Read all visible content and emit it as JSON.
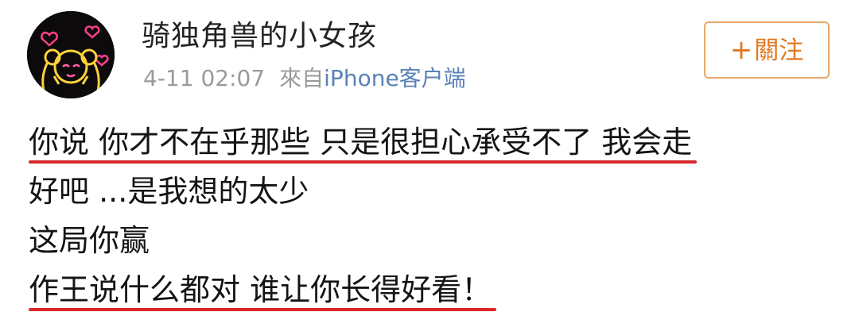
{
  "post": {
    "username": "骑独角兽的小女孩",
    "time": "4-11 02:07",
    "source_label": "來自",
    "source_device": "iPhone客户端",
    "follow_button": "關注",
    "lines": [
      "你说 你才不在乎那些 只是很担心承受不了 我会走",
      "好吧 ...是我想的太少",
      "这局你赢",
      "作王说什么都对 谁让你长得好看！"
    ]
  },
  "colors": {
    "underline": "#d8262a",
    "follow_text": "#e07a1f",
    "follow_border": "#e8a86a",
    "source_device": "#5a82b6",
    "meta": "#9a9a9a"
  },
  "icons": {
    "avatar": "sailor-moon-neon-avatar",
    "follow": "plus-icon"
  }
}
